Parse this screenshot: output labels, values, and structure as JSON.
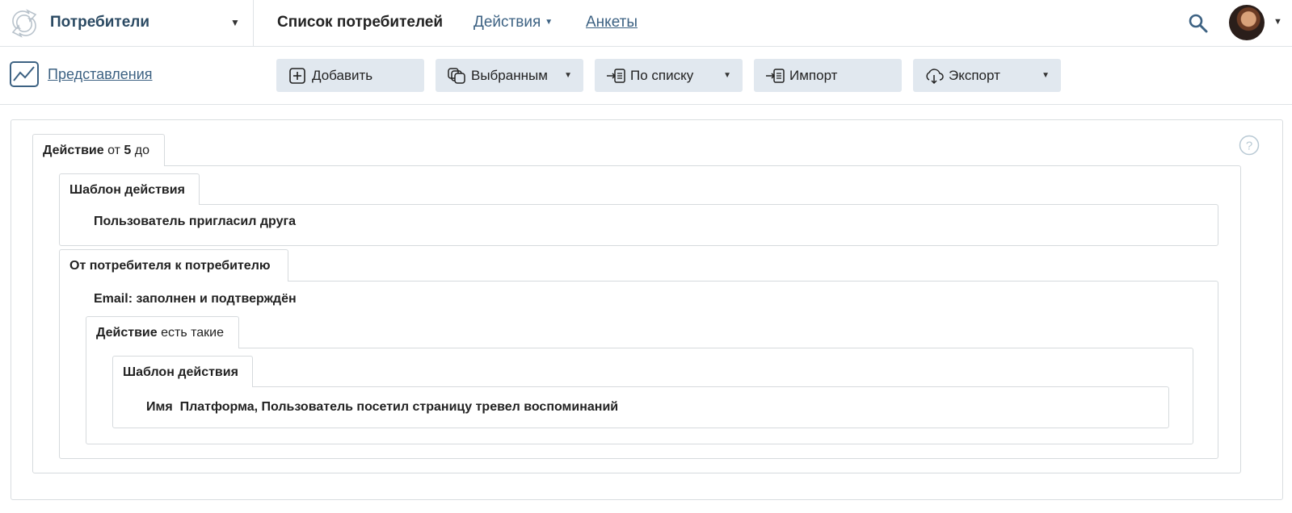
{
  "header": {
    "section_name": "Потребители",
    "page_title": "Список потребителей",
    "actions_label": "Действия",
    "forms_label": "Анкеты"
  },
  "toolbar": {
    "views_label": "Представления",
    "add_label": "Добавить",
    "selected_label": "Выбранным",
    "by_list_label": "По списку",
    "import_label": "Импорт",
    "export_label": "Экспорт"
  },
  "filter": {
    "action_tab": {
      "bold": "Действие",
      "from": "от",
      "count": "5",
      "to": "до"
    },
    "template_tab": "Шаблон действия",
    "template_value": "Пользователь пригласил друга",
    "relation_tab": "От потребителя к потребителю",
    "email_condition": "Email: заполнен и подтверждён",
    "inner_action_tab": {
      "bold": "Действие",
      "rest": "есть такие"
    },
    "inner_template_tab": "Шаблон действия",
    "inner_name_label": "Имя",
    "inner_name_value": "Платформа, Пользователь посетил страницу тревел воспоминаний"
  },
  "colors": {
    "accent": "#3d6283",
    "button_bg": "#e1e8ef",
    "border": "#d6dadd"
  }
}
